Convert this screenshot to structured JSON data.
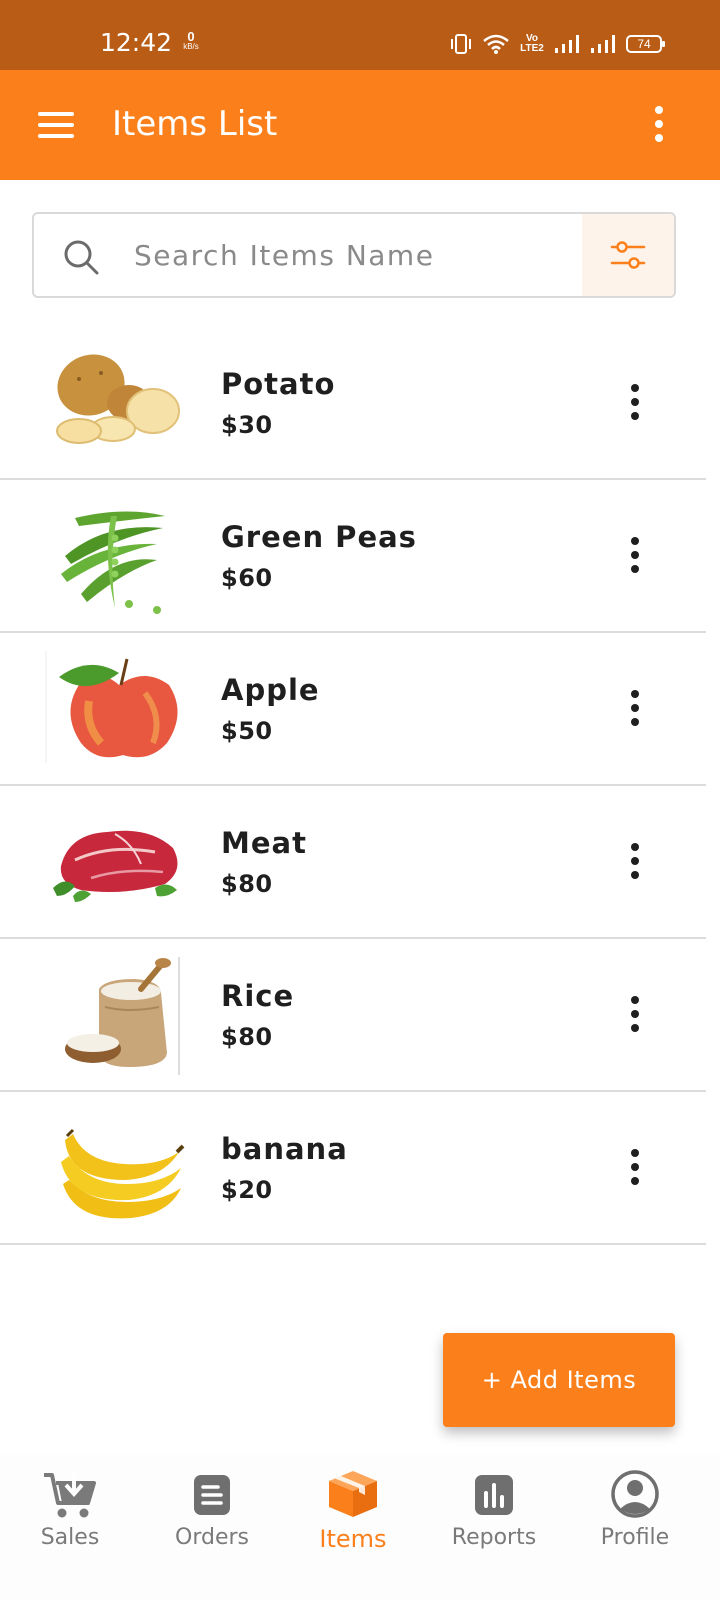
{
  "status_bar": {
    "time": "12:42",
    "net_speed_value": "0",
    "net_speed_unit": "kB/s",
    "volte_top": "Vo",
    "volte_bottom": "LTE2",
    "battery": "74"
  },
  "app_bar": {
    "title": "Items List"
  },
  "search": {
    "placeholder": "Search Items Name",
    "value": ""
  },
  "items": [
    {
      "name": "Potato",
      "price": "$30",
      "image": "potato"
    },
    {
      "name": "Green Peas",
      "price": "$60",
      "image": "green-peas"
    },
    {
      "name": "Apple",
      "price": "$50",
      "image": "apple"
    },
    {
      "name": "Meat",
      "price": "$80",
      "image": "meat"
    },
    {
      "name": "Rice",
      "price": "$80",
      "image": "rice"
    },
    {
      "name": "banana",
      "price": "$20",
      "image": "banana"
    }
  ],
  "fab": {
    "label": "+ Add Items"
  },
  "bottom_nav": [
    {
      "label": "Sales",
      "icon": "cart-download-icon",
      "active": false
    },
    {
      "label": "Orders",
      "icon": "document-icon",
      "active": false
    },
    {
      "label": "Items",
      "icon": "box-icon",
      "active": true
    },
    {
      "label": "Reports",
      "icon": "bar-chart-icon",
      "active": false
    },
    {
      "label": "Profile",
      "icon": "user-circle-icon",
      "active": false
    }
  ],
  "colors": {
    "status_bar": "#B95C16",
    "accent": "#FB801C",
    "filter_bg": "#FEF3EA",
    "nav_inactive": "#7a7a7a"
  }
}
